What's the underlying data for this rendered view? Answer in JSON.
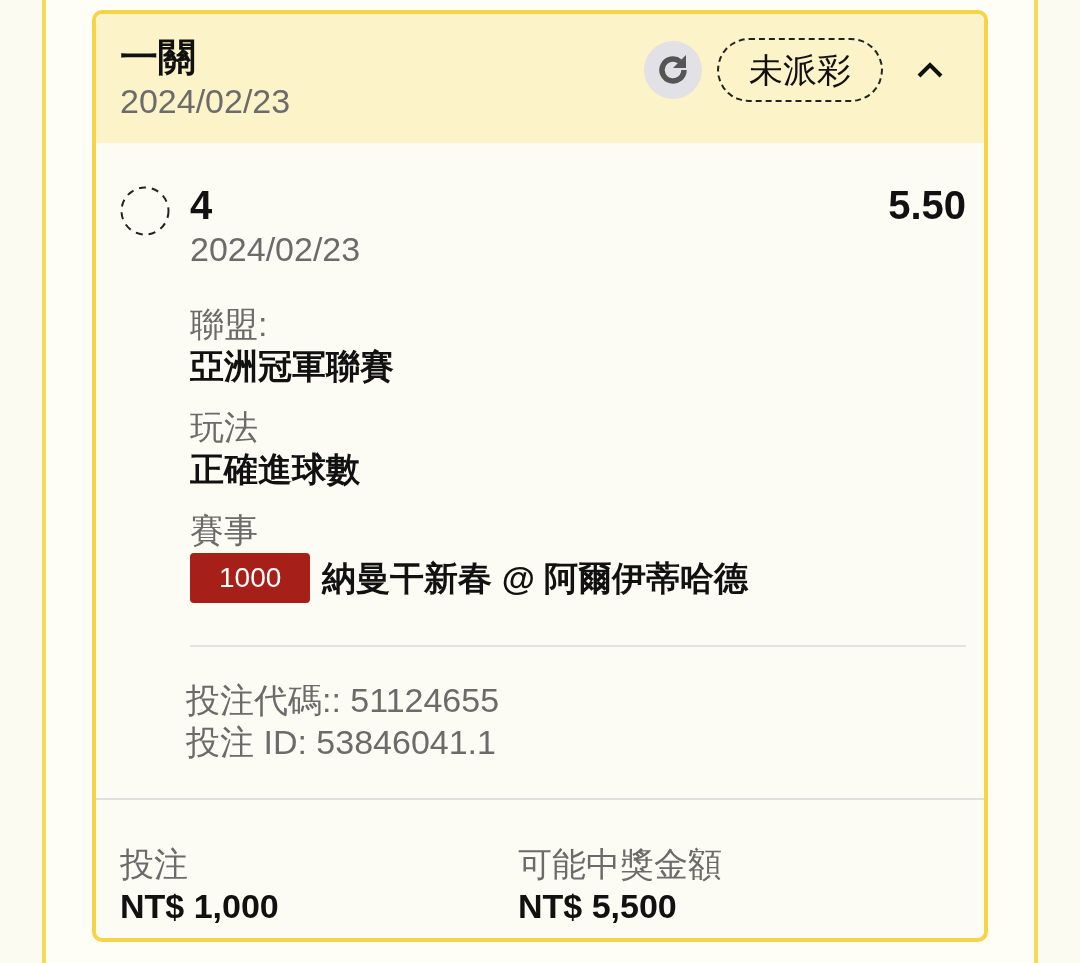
{
  "bet": {
    "title": "一關",
    "date": "2024/02/23",
    "status": "未派彩",
    "expanded": true
  },
  "legs": [
    {
      "settled": false,
      "selection": "4",
      "odds": "5.50",
      "date": "2024/02/23",
      "details": [
        {
          "kind": "text",
          "label": "聯盟:",
          "value": "亞洲冠軍聯賽"
        },
        {
          "kind": "text",
          "label": "玩法",
          "value": "正確進球數"
        },
        {
          "kind": "event",
          "label": "賽事",
          "code": "1000",
          "value": "納曼干新春 @ 阿爾伊蒂哈德"
        }
      ]
    }
  ],
  "references": [
    "投注代碼:: 51124655",
    "投注 ID: 53846041.1"
  ],
  "summary": [
    {
      "label": "投注",
      "value": "NT$ 1,000"
    },
    {
      "label": "可能中獎金額",
      "value": "NT$ 5,500"
    }
  ]
}
